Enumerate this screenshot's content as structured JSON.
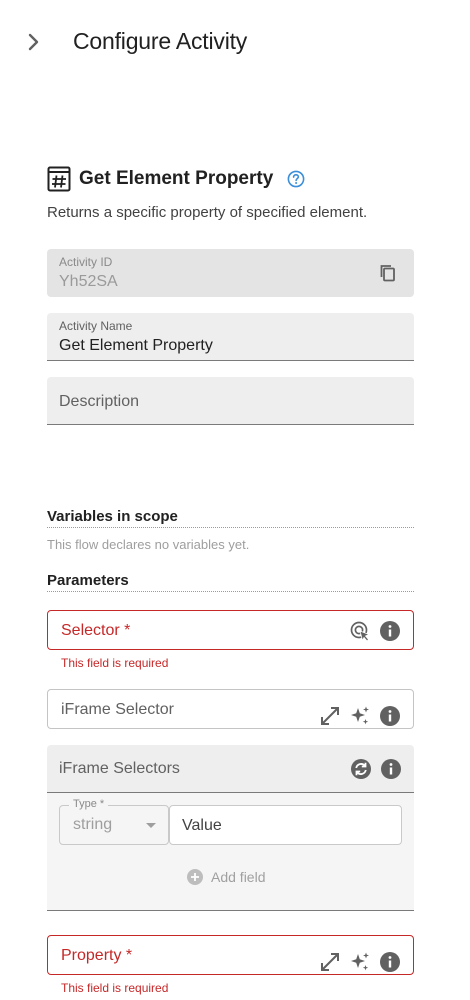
{
  "header": {
    "title": "Configure Activity",
    "toggle_icon": "chevron-right-icon"
  },
  "activity": {
    "icon": "hash-icon",
    "title": "Get Element Property",
    "help_icon": "help-circle-icon",
    "description": "Returns a specific property of specified element."
  },
  "fields": {
    "activity_id": {
      "label": "Activity ID",
      "value": "Yh52SA",
      "icon": "copy-icon"
    },
    "activity_name": {
      "label": "Activity Name",
      "value": "Get Element Property"
    },
    "description": {
      "placeholder": "Description"
    }
  },
  "variables": {
    "title": "Variables in scope",
    "note": "This flow declares no variables yet."
  },
  "parameters": {
    "title": "Parameters",
    "selector": {
      "label": "Selector *",
      "error": "This field is required",
      "icons": [
        "target-cursor-icon",
        "info-icon"
      ]
    },
    "iframe_selector": {
      "label": "iFrame Selector",
      "icons": [
        "expand-icon",
        "sparkle-icon",
        "info-icon"
      ]
    },
    "iframe_selectors": {
      "label": "iFrame Selectors",
      "icons": [
        "sync-icon",
        "info-icon"
      ],
      "type_label": "Type *",
      "type_value": "string",
      "value_placeholder": "Value",
      "add_label": "Add field"
    },
    "property": {
      "label": "Property *",
      "error": "This field is required",
      "icons": [
        "expand-icon",
        "sparkle-icon",
        "info-icon"
      ]
    }
  },
  "colors": {
    "error": "#c62828",
    "help": "#3b8fd9",
    "field_bg": "#eeeeee"
  }
}
